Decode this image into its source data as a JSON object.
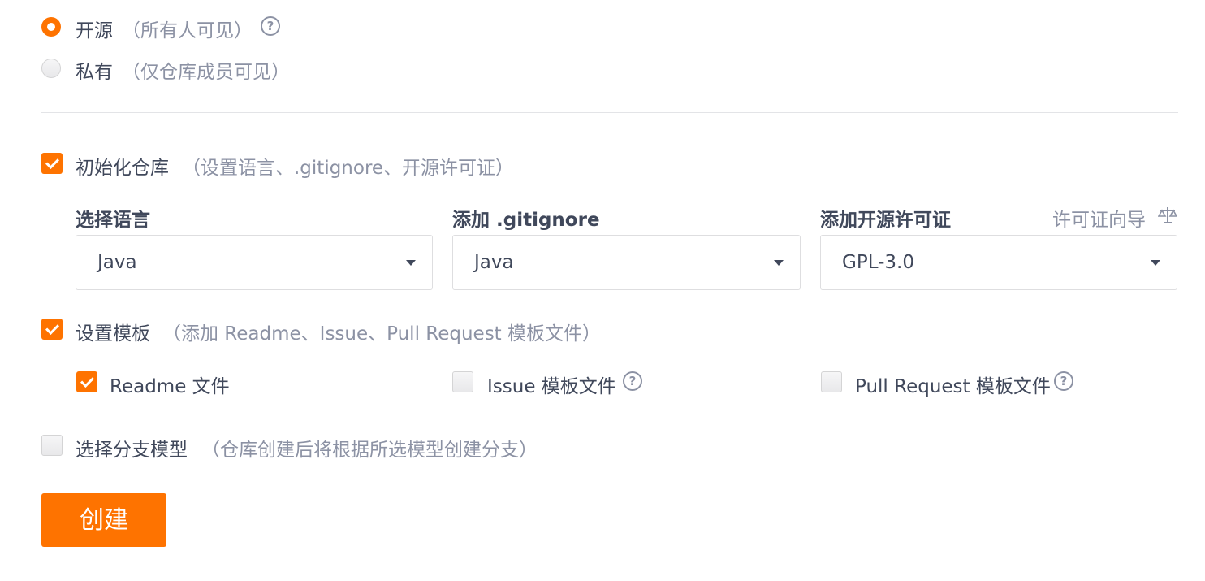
{
  "visibility": {
    "open": {
      "label": "开源",
      "hint": "（所有人可见）",
      "checked": true
    },
    "private": {
      "label": "私有",
      "hint": "（仅仓库成员可见）",
      "checked": false
    }
  },
  "init_repo": {
    "label": "初始化仓库",
    "hint": "（设置语言、.gitignore、开源许可证）",
    "checked": true,
    "language": {
      "title": "选择语言",
      "value": "Java"
    },
    "gitignore": {
      "title": "添加 .gitignore",
      "value": "Java"
    },
    "license": {
      "title": "添加开源许可证",
      "value": "GPL-3.0",
      "guide_label": "许可证向导"
    }
  },
  "template": {
    "label": "设置模板",
    "hint": "（添加 Readme、Issue、Pull Request 模板文件）",
    "checked": true,
    "readme": {
      "label": "Readme 文件",
      "checked": true
    },
    "issue": {
      "label": "Issue 模板文件",
      "checked": false
    },
    "pull_request": {
      "label": "Pull Request 模板文件",
      "checked": false
    }
  },
  "branch_model": {
    "label": "选择分支模型",
    "hint": "（仓库创建后将根据所选模型创建分支）",
    "checked": false
  },
  "create_button": "创建",
  "colors": {
    "accent": "#fe7300",
    "text": "#40485b",
    "muted": "#8c92a4"
  },
  "icons": {
    "help": "question-circle-icon",
    "license_guide": "scale-icon",
    "dropdown": "caret-down-icon"
  }
}
